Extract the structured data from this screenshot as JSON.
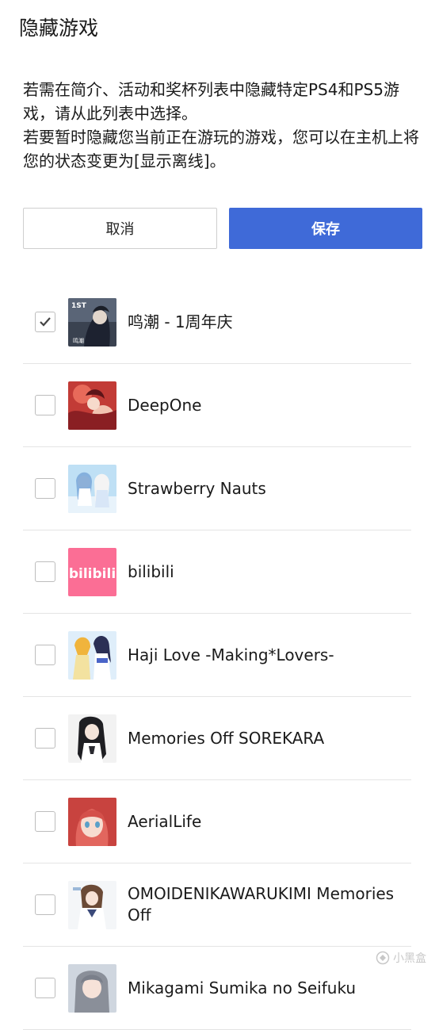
{
  "header": {
    "title": "隐藏游戏"
  },
  "description": {
    "line1": "若需在简介、活动和奖杯列表中隐藏特定PS4和PS5游戏，请从此列表中选择。",
    "line2": "若要暂时隐藏您当前正在游玩的游戏，您可以在主机上将您的状态变更为[显示离线]。"
  },
  "buttons": {
    "cancel": "取消",
    "save": "保存"
  },
  "colors": {
    "save_bg": "#3f6ad8",
    "divider": "#e4e4e4"
  },
  "games": [
    {
      "name": "鸣潮 - 1周年庆",
      "checked": true,
      "thumb_icon": "wuthering-waves-thumbnail"
    },
    {
      "name": "DeepOne",
      "checked": false,
      "thumb_icon": "deepone-thumbnail"
    },
    {
      "name": "Strawberry Nauts",
      "checked": false,
      "thumb_icon": "strawberry-nauts-thumbnail"
    },
    {
      "name": "bilibili",
      "checked": false,
      "thumb_icon": "bilibili-thumbnail"
    },
    {
      "name": "Haji Love -Making*Lovers-",
      "checked": false,
      "thumb_icon": "haji-love-thumbnail"
    },
    {
      "name": "Memories Off SOREKARA",
      "checked": false,
      "thumb_icon": "memories-off-sorekara-thumbnail"
    },
    {
      "name": "AerialLife",
      "checked": false,
      "thumb_icon": "aeriallife-thumbnail"
    },
    {
      "name": "OMOIDENIKAWARUKIMI Memories Off",
      "checked": false,
      "thumb_icon": "omoidenikawarukimi-thumbnail"
    },
    {
      "name": "Mikagami Sumika no Seifuku",
      "checked": false,
      "thumb_icon": "mikagami-sumika-thumbnail"
    }
  ],
  "watermark": {
    "text": "小黑盒"
  }
}
